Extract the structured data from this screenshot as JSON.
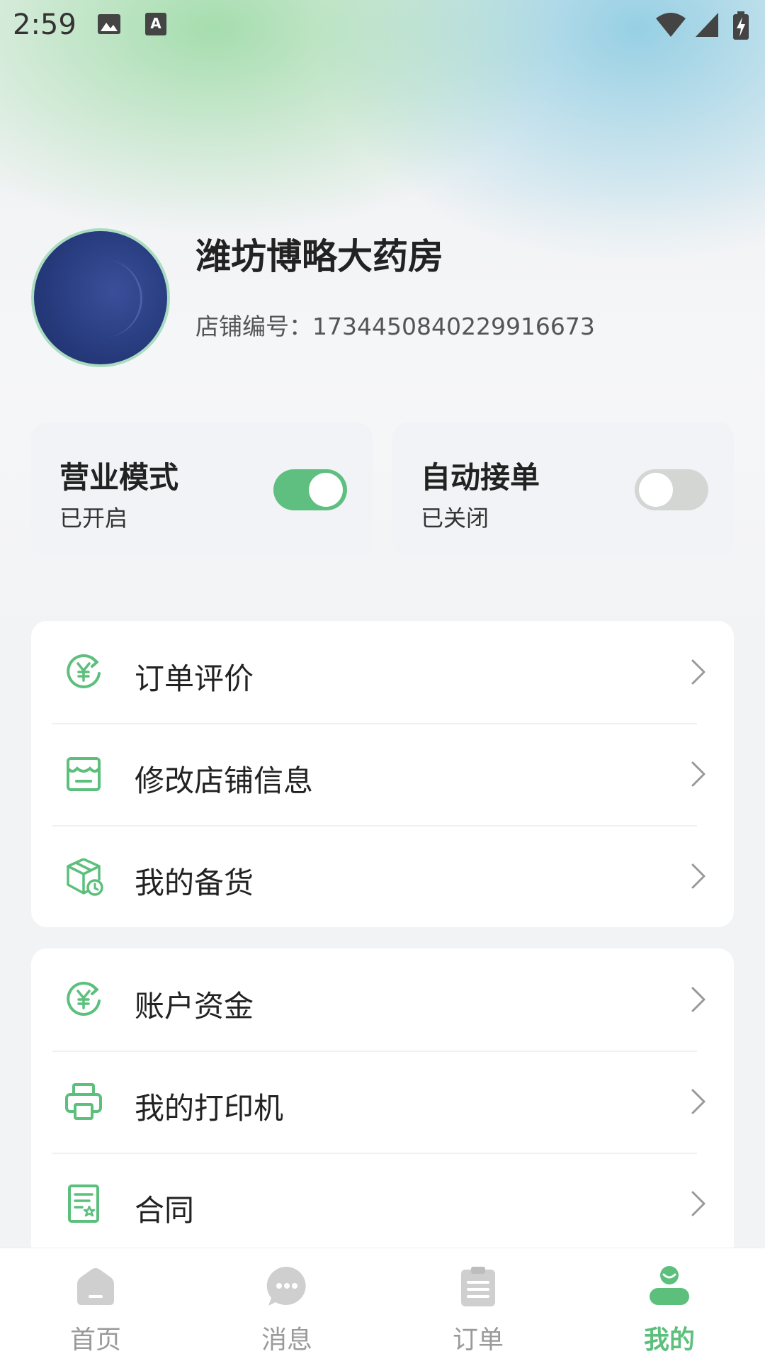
{
  "status_bar": {
    "time": "2:59",
    "icons": [
      "image-icon",
      "keyboard-a-icon",
      "wifi-icon",
      "signal-icon",
      "battery-charging-icon"
    ]
  },
  "profile": {
    "store_name": "潍坊博略大药房",
    "store_id_label": "店铺编号：",
    "store_id": "1734450840229916673"
  },
  "modes": [
    {
      "title": "营业模式",
      "status": "已开启",
      "enabled": true
    },
    {
      "title": "自动接单",
      "status": "已关闭",
      "enabled": false
    }
  ],
  "menu_group_1": [
    {
      "label": "订单评价",
      "icon": "yuan-refresh-icon"
    },
    {
      "label": "修改店铺信息",
      "icon": "store-icon"
    },
    {
      "label": "我的备货",
      "icon": "box-clock-icon"
    }
  ],
  "menu_group_2": [
    {
      "label": "账户资金",
      "icon": "yuan-refresh-icon"
    },
    {
      "label": "我的打印机",
      "icon": "printer-icon"
    },
    {
      "label": "合同",
      "icon": "contract-icon"
    }
  ],
  "bottom_nav": [
    {
      "label": "首页",
      "icon": "home-icon",
      "active": false
    },
    {
      "label": "消息",
      "icon": "chat-icon",
      "active": false
    },
    {
      "label": "订单",
      "icon": "clipboard-icon",
      "active": false
    },
    {
      "label": "我的",
      "icon": "user-icon",
      "active": true
    }
  ],
  "colors": {
    "accent_green": "#5cbf7c",
    "toggle_on": "#5fbf80",
    "toggle_off": "#d4d6d4",
    "nav_inactive": "#9a9a9a"
  }
}
